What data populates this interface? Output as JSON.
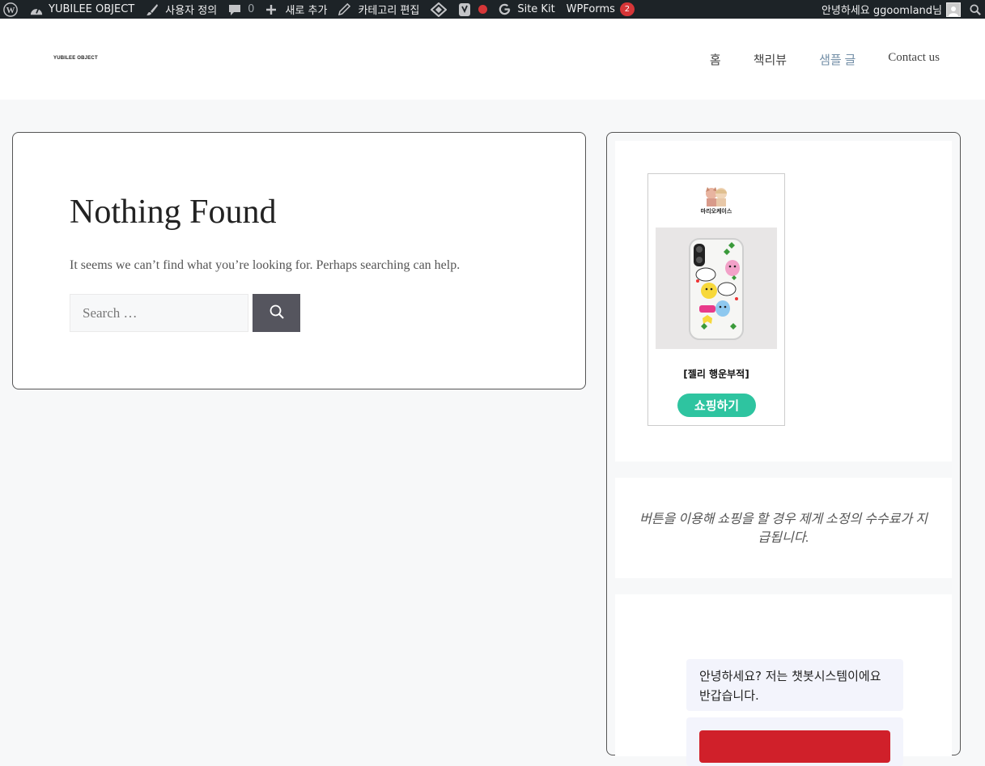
{
  "adminbar": {
    "site_name": "YUBILEE OBJECT",
    "customize": "사용자 정의",
    "comments_count": "0",
    "new_item": "새로 추가",
    "edit_category": "카테고리 편집",
    "site_kit": "Site Kit",
    "wpforms": "WPForms",
    "wpforms_badge": "2",
    "greeting": "안녕하세요 ggoomland님"
  },
  "header": {
    "logo_text": "YUBILEE OBJECT",
    "nav": [
      {
        "label": "홈"
      },
      {
        "label": "책리뷰"
      },
      {
        "label": "샘플 글"
      },
      {
        "label": "Contact us"
      }
    ]
  },
  "main": {
    "title": "Nothing Found",
    "message": "It seems we can’t find what you’re looking for. Perhaps searching can help.",
    "search_placeholder": "Search …"
  },
  "sidebar": {
    "ad": {
      "brand": "마리오케이스",
      "product_name": "[젤리 행운부적]",
      "button_label": "쇼핑하기",
      "button_color": "#2ec4a0"
    },
    "disclaimer": "버튼을 이용해 쇼핑을 할 경우 제게 소정의 수수료가 지급됩니다.",
    "chatbot": {
      "message": "안녕하세요? 저는 챗봇시스템이에요 반갑습니다."
    }
  },
  "colors": {
    "adminbar_bg": "#1d2327",
    "accent_nav": "#7590a8",
    "search_button": "#55555e",
    "badge_red": "#d63638",
    "chat_red": "#d0202a"
  }
}
